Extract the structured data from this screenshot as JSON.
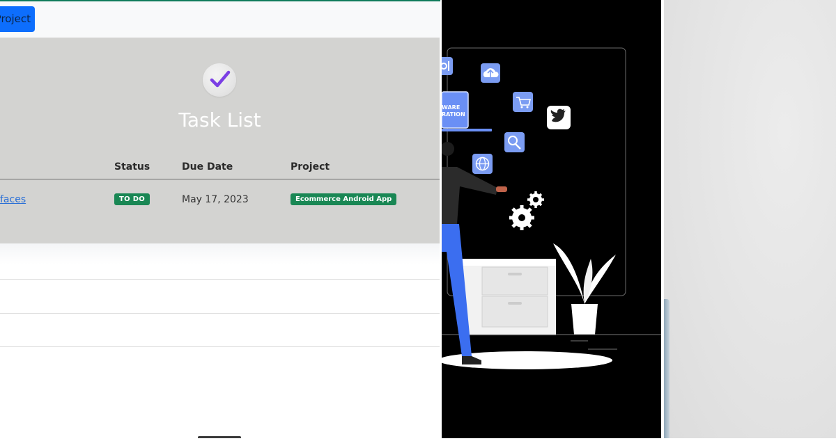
{
  "toolbar": {
    "new_project_label": "Project"
  },
  "task_panel": {
    "title": "Task List",
    "columns": {
      "status": "Status",
      "due_date": "Due Date",
      "project": "Project"
    },
    "rows": [
      {
        "task": "faces",
        "status": "TO DO",
        "due_date": "May 17, 2023",
        "project": "Ecommerce Android App"
      }
    ]
  },
  "illustration": {
    "screen_text_line1": "WARE",
    "screen_text_line2": "RATION",
    "icons": [
      "settings-icon",
      "cloud-upload-icon",
      "cart-icon",
      "twitter-icon",
      "search-icon",
      "globe-icon",
      "gears-icon"
    ]
  },
  "colors": {
    "primary_button": "#0d6efd",
    "badge_green": "#198754",
    "card_background": "#d3d3d1",
    "check_purple": "#7b3fe4",
    "illustration_blue": "#3b6ef0"
  }
}
